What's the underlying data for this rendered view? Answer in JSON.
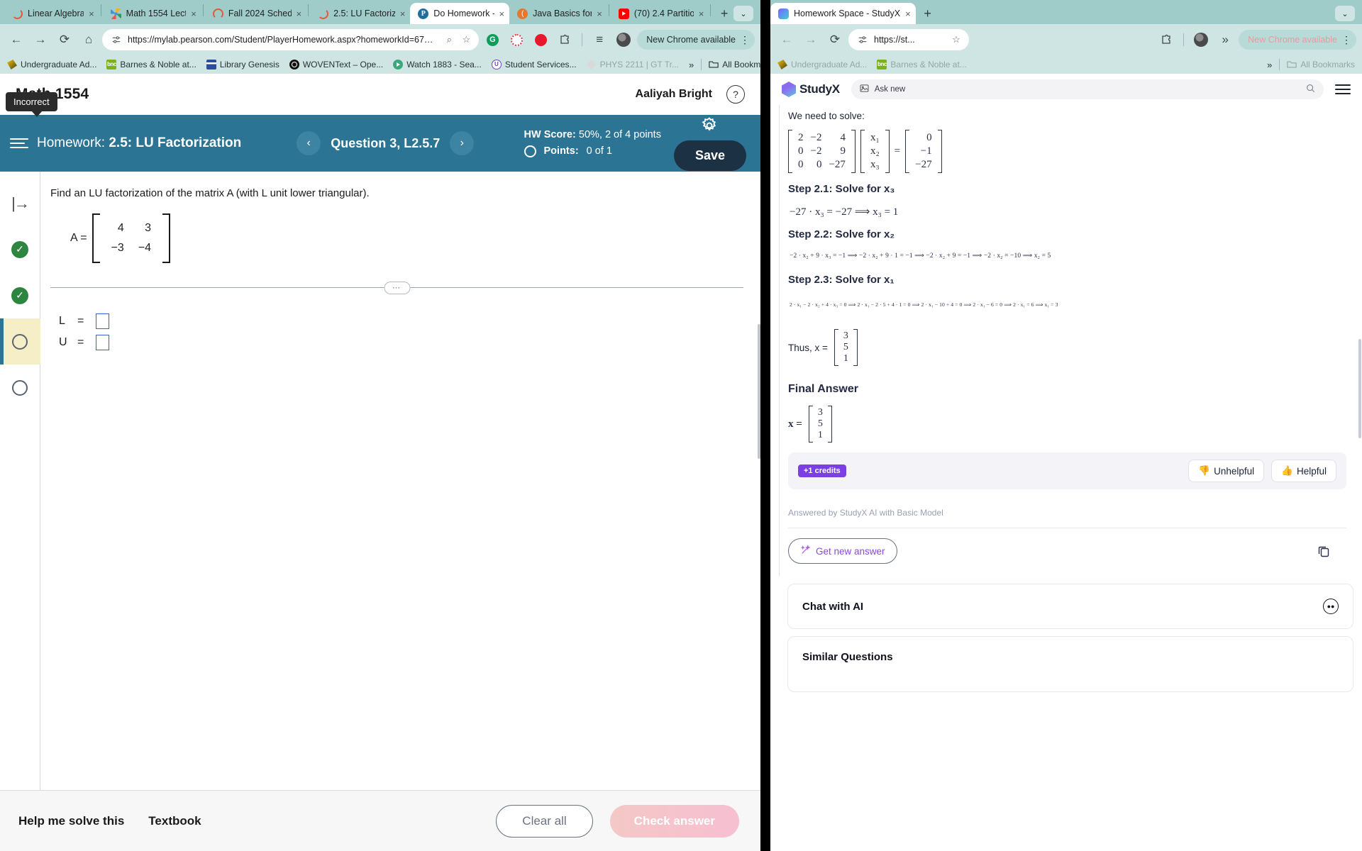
{
  "left_window": {
    "tabs": [
      {
        "title": "Linear Algebra",
        "icon": "pearson-ring-icon",
        "active": false
      },
      {
        "title": "Math 1554 Lect",
        "icon": "colorful-star-icon",
        "active": false
      },
      {
        "title": "Fall 2024 Sched",
        "icon": "pearson-ring-icon",
        "active": false
      },
      {
        "title": "2.5: LU Factoriz",
        "icon": "pearson-ring-icon",
        "active": false
      },
      {
        "title": "Do Homework -",
        "icon": "pearson-icon",
        "active": true
      },
      {
        "title": "Java Basics for",
        "icon": "java-icon",
        "active": false
      },
      {
        "title": "(70) 2.4 Partitio",
        "icon": "youtube-icon",
        "active": false
      }
    ],
    "new_tab_label": "+",
    "tab_close_label": "×",
    "tabstrip_chevron": "⌄",
    "toolbar": {
      "back": "←",
      "forward": "→",
      "reload": "⟳",
      "home": "⌂",
      "url": "https://mylab.pearson.com/Student/PlayerHomework.aspx?homeworkId=677625858&que...",
      "site_settings_icon": "tune-icon",
      "zoom_icon": "⌕",
      "bookmark_icon": "☆",
      "extensions": [
        "grammarly-icon",
        "bc-icon",
        "opera-icon",
        "puzzle-icon"
      ],
      "reading_list_icon": "≡",
      "update_label": "New Chrome available",
      "menu_icon": "⋮"
    },
    "bookmarks": [
      {
        "label": "Undergraduate Ad...",
        "icon": "bookmark-icon-1"
      },
      {
        "label": "Barnes & Noble at...",
        "icon": "bnc-icon"
      },
      {
        "label": "Library Genesis",
        "icon": "libgen-icon"
      },
      {
        "label": "WOVENText – Ope...",
        "icon": "woven-icon"
      },
      {
        "label": "Watch 1883 - Sea...",
        "icon": "play-icon"
      },
      {
        "label": "Student Services...",
        "icon": "student-services-icon"
      },
      {
        "label": "PHYS 2211 | GT Tr...",
        "icon": "phys-icon"
      }
    ],
    "bookmarks_overflow": "»",
    "all_bookmarks_label": "All Bookmarks"
  },
  "right_window": {
    "tabs": [
      {
        "title": "Homework Space - StudyX",
        "icon": "studyx-icon",
        "active": true
      }
    ],
    "new_tab_label": "+",
    "tab_close_label": "×",
    "tabstrip_chevron": "⌄",
    "toolbar": {
      "back": "←",
      "forward": "→",
      "reload": "⟳",
      "url": "https://st...",
      "bookmark_icon": "☆",
      "update_label": "New Chrome available",
      "menu_icon": "⋮",
      "overflow_icon": "»"
    },
    "bookmarks": [
      {
        "label": "Undergraduate Ad...",
        "icon": "bookmark-icon-1"
      },
      {
        "label": "Barnes & Noble at...",
        "icon": "bnc-icon"
      }
    ],
    "bookmarks_overflow": "»",
    "all_bookmarks_label": "All Bookmarks"
  },
  "pearson": {
    "course_title": "Math 1554",
    "user_name": "Aaliyah Bright",
    "help_icon": "?",
    "tooltip": "Incorrect",
    "homework_label": "Homework:",
    "homework_title": "2.5: LU Factorization",
    "prev_icon": "‹",
    "next_icon": "›",
    "question_label": "Question 3, L2.5.7",
    "hw_score_label": "HW Score:",
    "hw_score_value": "50%, 2 of 4 points",
    "points_label": "Points:",
    "points_value": "0 of 1",
    "settings_icon": "gear-icon",
    "save_label": "Save",
    "rail": [
      {
        "type": "next-question-arrow-icon"
      },
      {
        "type": "correct-check-icon"
      },
      {
        "type": "correct-check-icon"
      },
      {
        "type": "open-circle-icon",
        "selected": true
      },
      {
        "type": "open-circle-icon",
        "selected": false
      }
    ],
    "question_text": "Find an LU factorization of the matrix A (with L unit lower triangular).",
    "matrix_A_label": "A =",
    "matrix_A": [
      [
        "4",
        "3"
      ],
      [
        "−3",
        "−4"
      ]
    ],
    "divider_dots": "⋯",
    "answer_rows": [
      {
        "label": "L",
        "eq": "=",
        "value": ""
      },
      {
        "label": "U",
        "eq": "=",
        "value": ""
      }
    ],
    "footer": {
      "help_label": "Help me solve this",
      "textbook_label": "Textbook",
      "clear_label": "Clear all",
      "check_label": "Check answer"
    }
  },
  "studyx": {
    "brand": "StudyX",
    "search_placeholder": "Ask new",
    "search_image_icon": "image-icon",
    "search_magnifier_icon": "search-icon",
    "menu_icon": "hamburger-icon",
    "intro_text": "We need to solve:",
    "system": {
      "coefficients": [
        [
          "2",
          "−2",
          "4"
        ],
        [
          "0",
          "−2",
          "9"
        ],
        [
          "0",
          "0",
          "−27"
        ]
      ],
      "unknowns": [
        "x₁",
        "x₂",
        "x₃"
      ],
      "equals": "=",
      "rhs": [
        "0",
        "−1",
        "−27"
      ]
    },
    "steps": [
      {
        "title": "Step 2.1: Solve for x₃",
        "equation": "−27 · x₃ = −27  ⟹  x₃ = 1",
        "size": "md"
      },
      {
        "title": "Step 2.2: Solve for x₂",
        "equation": "−2 · x₂ + 9 · x₃ = −1 ⟹ −2 · x₂ + 9 · 1 = −1 ⟹ −2 · x₂ + 9 = −1 ⟹ −2 · x₂ = −10 ⟹ x₂ = 5",
        "size": "sm"
      },
      {
        "title": "Step 2.3: Solve for x₁",
        "equation": "2 · x₁ − 2 · x₂ + 4 · x₃ = 0 ⟹ 2 · x₁ − 2 · 5 + 4 · 1 = 0 ⟹ 2 · x₁ − 10 + 4 = 0 ⟹ 2 · x₁ − 6 = 0 ⟹ 2 · x₁ = 6 ⟹ x₁ = 3",
        "size": "xs"
      }
    ],
    "thus_label": "Thus, x =",
    "thus_vector": [
      "3",
      "5",
      "1"
    ],
    "final_answer_title": "Final Answer",
    "final_label": "x =",
    "final_vector": [
      "3",
      "5",
      "1"
    ],
    "credits_badge": "+1 credits",
    "unhelpful_label": "Unhelpful",
    "unhelpful_icon": "thumbs-down-icon",
    "helpful_label": "Helpful",
    "helpful_icon": "thumbs-up-icon",
    "answered_by": "Answered by StudyX AI with Basic Model",
    "get_new_answer_label": "Get new answer",
    "magic_icon": "magic-wand-icon",
    "copy_icon": "copy-icon",
    "chat_title": "Chat with AI",
    "chat_icon": "bot-icon",
    "similar_title": "Similar Questions"
  },
  "colors": {
    "chrome_bg": "#cfe5e3",
    "pearson_band": "#2c7494",
    "save_dark": "#1c3144",
    "studyx_purple": "#7b3fe4",
    "check_green": "#2e8540"
  }
}
